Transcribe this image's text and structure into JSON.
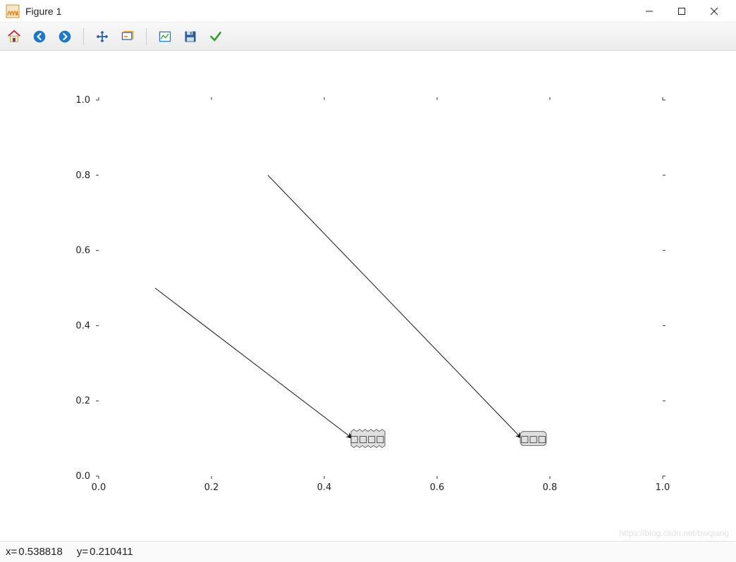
{
  "window": {
    "title": "Figure 1"
  },
  "toolbar": {
    "home": "Home",
    "back": "Back",
    "forward": "Forward",
    "pan": "Pan",
    "zoom": "Zoom",
    "subplots": "Configure subplots",
    "save": "Save",
    "ok": "OK"
  },
  "status": {
    "x_label": "x=",
    "x_value": "0.538818",
    "y_label": "y=",
    "y_value": "0.210411"
  },
  "watermark": "https://blog.csdn.net/bwqiang",
  "chart_data": {
    "type": "line",
    "title": "",
    "xlabel": "",
    "ylabel": "",
    "xlim": [
      0.0,
      1.0
    ],
    "ylim": [
      0.0,
      1.0
    ],
    "xticks": [
      0.0,
      0.2,
      0.4,
      0.6,
      0.8,
      1.0
    ],
    "yticks": [
      0.0,
      0.2,
      0.4,
      0.6,
      0.8,
      1.0
    ],
    "xtick_labels": [
      "0.0",
      "0.2",
      "0.4",
      "0.6",
      "0.8",
      "1.0"
    ],
    "ytick_labels": [
      "0.0",
      "0.2",
      "0.4",
      "0.6",
      "0.8",
      "1.0"
    ],
    "annotations": [
      {
        "text": "□□□□",
        "xy": [
          0.45,
          0.1
        ],
        "xytext": [
          0.1,
          0.5
        ],
        "box_style": "sawtooth",
        "arrow": true
      },
      {
        "text": "□□□",
        "xy": [
          0.75,
          0.1
        ],
        "xytext": [
          0.3,
          0.8
        ],
        "box_style": "round",
        "arrow": true
      }
    ]
  }
}
